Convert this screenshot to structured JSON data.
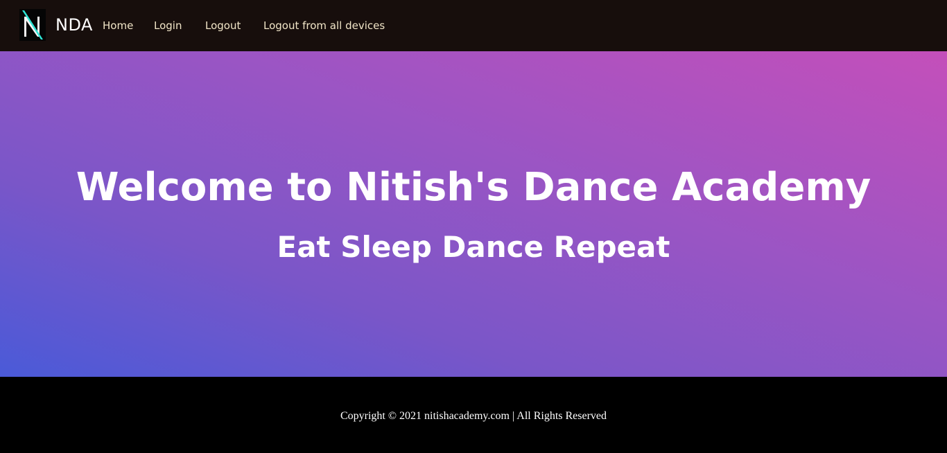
{
  "navbar": {
    "logo_letter": "N",
    "brand": "NDA",
    "links": [
      {
        "label": "Home"
      },
      {
        "label": "Login"
      },
      {
        "label": "Logout"
      },
      {
        "label": "Logout from all devices"
      }
    ]
  },
  "hero": {
    "title": "Welcome to Nitish's Dance Academy",
    "subtitle": "Eat Sleep Dance Repeat"
  },
  "footer": {
    "copyright": "Copyright © 2021 nitishacademy.com | All Rights Reserved"
  },
  "colors": {
    "navbar_bg": "#170e0c",
    "nav_link": "#f2e6c8",
    "logo_accent": "#2ee6d6",
    "hero_gradient_start": "#4a5ad8",
    "hero_gradient_end": "#c44fba",
    "footer_bg": "#000000"
  }
}
